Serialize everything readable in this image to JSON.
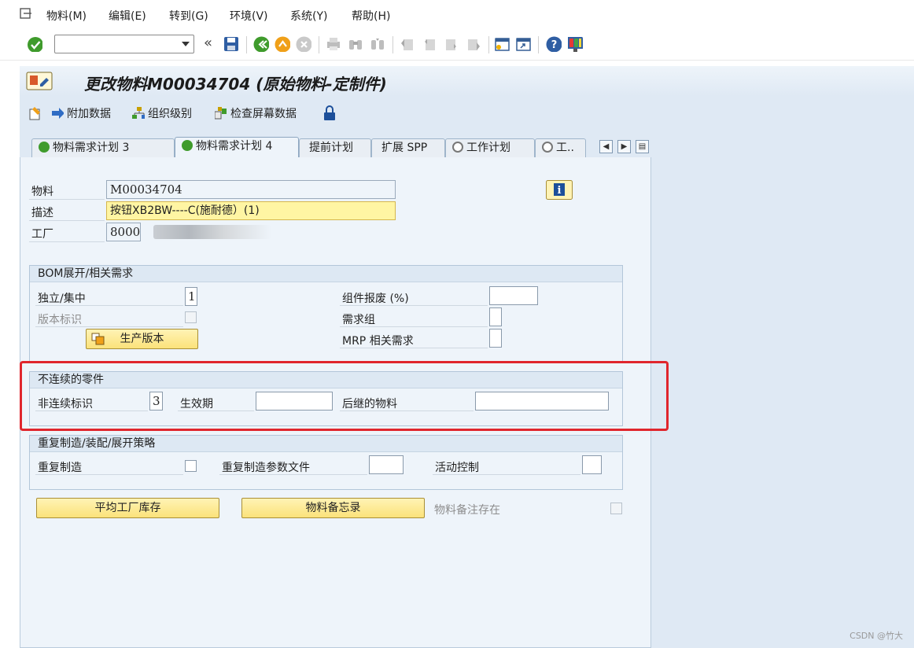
{
  "menubar": {
    "items": [
      "物料(M)",
      "编辑(E)",
      "转到(G)",
      "环境(V)",
      "系统(Y)",
      "帮助(H)"
    ]
  },
  "toolbar": {
    "command_field": "",
    "icons": [
      "enter-icon",
      "save-icon",
      "back-icon",
      "exit-icon",
      "cancel-icon",
      "print-icon",
      "find-icon",
      "find-next-icon",
      "first-page-icon",
      "prev-page-icon",
      "next-page-icon",
      "last-page-icon",
      "new-session-icon",
      "shortcut-icon",
      "help-icon",
      "layout-icon"
    ]
  },
  "header": {
    "title": "更改物料M00034704 (原始物料-定制件)"
  },
  "app_toolbar": {
    "additional_data": "附加数据",
    "org_levels": "组织级别",
    "check_screen_data": "检查屏幕数据"
  },
  "tabs": [
    {
      "label": "物料需求计划 3",
      "active": false
    },
    {
      "label": "物料需求计划 4",
      "active": true
    },
    {
      "label": "提前计划",
      "active": false
    },
    {
      "label": "扩展 SPP",
      "active": false
    },
    {
      "label": "工作计划",
      "active": false
    },
    {
      "label": "工..",
      "active": false
    }
  ],
  "header_fields": {
    "material_label": "物料",
    "material_value": "M00034704",
    "description_label": "描述",
    "description_value": "按钮XB2BW----C(施耐德）(1)",
    "plant_label": "工厂",
    "plant_value": "8000"
  },
  "bom_group": {
    "title": "BOM展开/相关需求",
    "indiv_coll_label": "独立/集中",
    "indiv_coll_value": "1",
    "version_indicator_label": "版本标识",
    "production_version_button": "生产版本",
    "component_scrap_label": "组件报废 (%)",
    "component_scrap_value": "",
    "requirements_group_label": "需求组",
    "requirements_group_value": "",
    "mrp_dep_req_label": "MRP 相关需求",
    "mrp_dep_req_value": ""
  },
  "discontinued_group": {
    "title": "不连续的零件",
    "disc_indicator_label": "非连续标识",
    "disc_indicator_value": "3",
    "effective_out_label": "生效期",
    "effective_out_value": "",
    "follow_up_material_label": "后继的物料",
    "follow_up_material_value": ""
  },
  "repetitive_group": {
    "title": "重复制造/装配/展开策略",
    "repetitive_mfg_label": "重复制造",
    "rem_profile_label": "重复制造参数文件",
    "rem_profile_value": "",
    "action_control_label": "活动控制",
    "action_control_value": ""
  },
  "bottom": {
    "avg_plant_stock_button": "平均工厂库存",
    "material_memo_button": "物料备忘录",
    "material_memo_exists_label": "物料备注存在"
  },
  "watermark": "CSDN @竹大",
  "colors": {
    "highlight_box": "#e0262d",
    "button_yellow": "#fbe27a",
    "panel_bg": "#eef4fa"
  }
}
